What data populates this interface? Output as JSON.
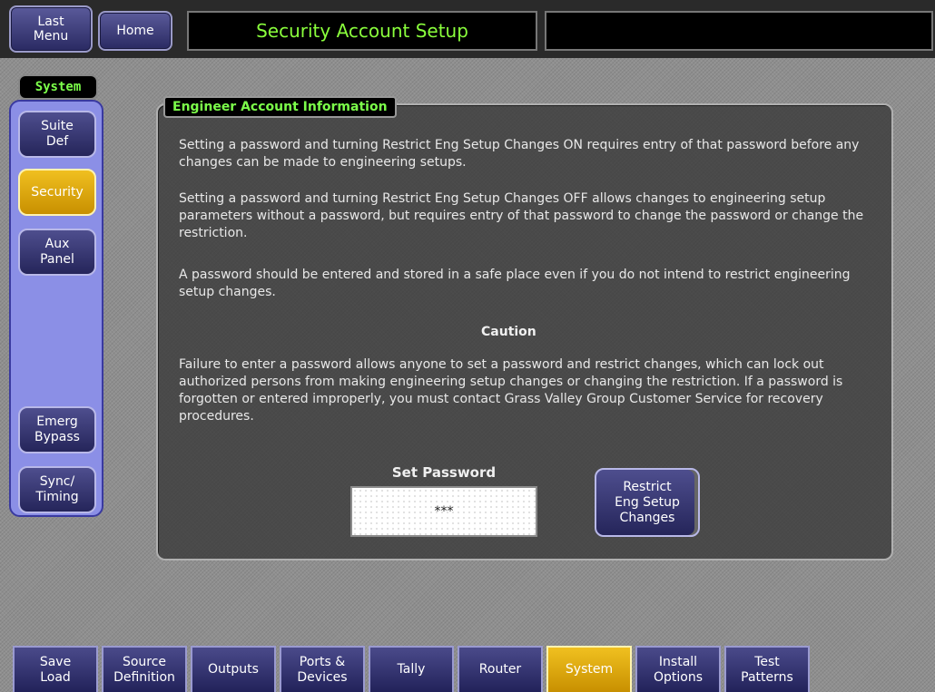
{
  "topbar": {
    "last_menu": "Last\nMenu",
    "home": "Home",
    "title": "Security Account Setup"
  },
  "sidebar": {
    "label": "System",
    "items": [
      {
        "label": "Suite\nDef"
      },
      {
        "label": "Security"
      },
      {
        "label": "Aux\nPanel"
      },
      {
        "label": "Emerg\nBypass"
      },
      {
        "label": "Sync/\nTiming"
      }
    ]
  },
  "panel": {
    "header": "Engineer Account Information",
    "para1": "Setting a password and turning Restrict Eng Setup Changes ON requires entry of that password before any changes can be made to engineering setups.",
    "para2": "Setting a password and turning Restrict Eng Setup Changes OFF allows changes to engineering setup parameters without a password, but requires entry of that password to change the password or change the restriction.",
    "para3": "A password should be entered and stored in a safe place even if you do not intend to restrict engineering setup changes.",
    "caution_title": "Caution",
    "caution_text": "Failure to enter a password allows anyone to set a password and restrict changes, which can lock out authorized persons from making engineering setup changes or changing the restriction. If a password is forgotten or entered improperly, you must contact Grass Valley Group Customer Service for recovery procedures.",
    "password_label": "Set Password",
    "password_value": "***",
    "restrict_button": "Restrict\nEng Setup\nChanges"
  },
  "tabs": [
    {
      "label": "Save\nLoad"
    },
    {
      "label": "Source\nDefinition"
    },
    {
      "label": "Outputs"
    },
    {
      "label": "Ports &\nDevices"
    },
    {
      "label": "Tally"
    },
    {
      "label": "Router"
    },
    {
      "label": "System"
    },
    {
      "label": "Install\nOptions"
    },
    {
      "label": "Test\nPatterns"
    }
  ],
  "colors": {
    "accent_green": "#7cff4a",
    "active_yellow": "#f0c020",
    "button_blue": "#3a3a78"
  }
}
